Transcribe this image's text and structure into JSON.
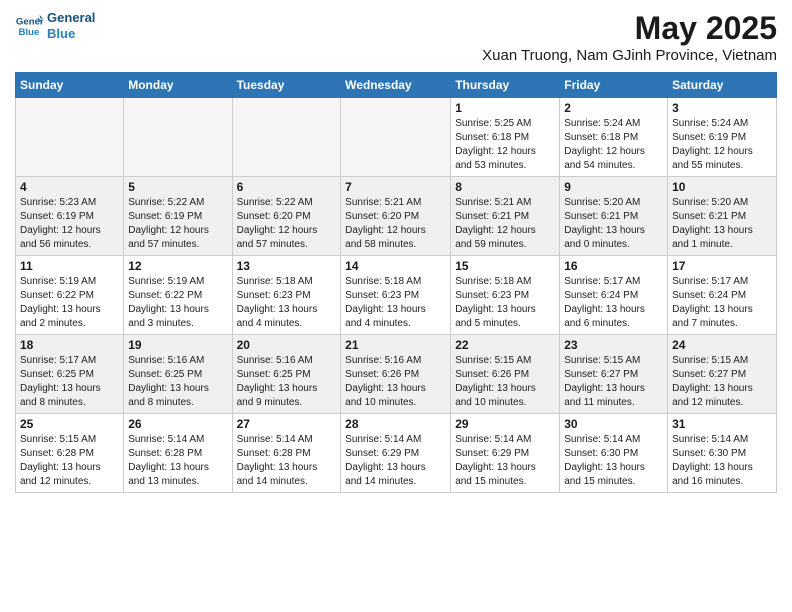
{
  "header": {
    "logo_line1": "General",
    "logo_line2": "Blue",
    "title": "May 2025",
    "subtitle": "Xuan Truong, Nam GJinh Province, Vietnam"
  },
  "columns": [
    "Sunday",
    "Monday",
    "Tuesday",
    "Wednesday",
    "Thursday",
    "Friday",
    "Saturday"
  ],
  "weeks": [
    [
      {
        "day": "",
        "info": ""
      },
      {
        "day": "",
        "info": ""
      },
      {
        "day": "",
        "info": ""
      },
      {
        "day": "",
        "info": ""
      },
      {
        "day": "1",
        "info": "Sunrise: 5:25 AM\nSunset: 6:18 PM\nDaylight: 12 hours\nand 53 minutes."
      },
      {
        "day": "2",
        "info": "Sunrise: 5:24 AM\nSunset: 6:18 PM\nDaylight: 12 hours\nand 54 minutes."
      },
      {
        "day": "3",
        "info": "Sunrise: 5:24 AM\nSunset: 6:19 PM\nDaylight: 12 hours\nand 55 minutes."
      }
    ],
    [
      {
        "day": "4",
        "info": "Sunrise: 5:23 AM\nSunset: 6:19 PM\nDaylight: 12 hours\nand 56 minutes."
      },
      {
        "day": "5",
        "info": "Sunrise: 5:22 AM\nSunset: 6:19 PM\nDaylight: 12 hours\nand 57 minutes."
      },
      {
        "day": "6",
        "info": "Sunrise: 5:22 AM\nSunset: 6:20 PM\nDaylight: 12 hours\nand 57 minutes."
      },
      {
        "day": "7",
        "info": "Sunrise: 5:21 AM\nSunset: 6:20 PM\nDaylight: 12 hours\nand 58 minutes."
      },
      {
        "day": "8",
        "info": "Sunrise: 5:21 AM\nSunset: 6:21 PM\nDaylight: 12 hours\nand 59 minutes."
      },
      {
        "day": "9",
        "info": "Sunrise: 5:20 AM\nSunset: 6:21 PM\nDaylight: 13 hours\nand 0 minutes."
      },
      {
        "day": "10",
        "info": "Sunrise: 5:20 AM\nSunset: 6:21 PM\nDaylight: 13 hours\nand 1 minute."
      }
    ],
    [
      {
        "day": "11",
        "info": "Sunrise: 5:19 AM\nSunset: 6:22 PM\nDaylight: 13 hours\nand 2 minutes."
      },
      {
        "day": "12",
        "info": "Sunrise: 5:19 AM\nSunset: 6:22 PM\nDaylight: 13 hours\nand 3 minutes."
      },
      {
        "day": "13",
        "info": "Sunrise: 5:18 AM\nSunset: 6:23 PM\nDaylight: 13 hours\nand 4 minutes."
      },
      {
        "day": "14",
        "info": "Sunrise: 5:18 AM\nSunset: 6:23 PM\nDaylight: 13 hours\nand 4 minutes."
      },
      {
        "day": "15",
        "info": "Sunrise: 5:18 AM\nSunset: 6:23 PM\nDaylight: 13 hours\nand 5 minutes."
      },
      {
        "day": "16",
        "info": "Sunrise: 5:17 AM\nSunset: 6:24 PM\nDaylight: 13 hours\nand 6 minutes."
      },
      {
        "day": "17",
        "info": "Sunrise: 5:17 AM\nSunset: 6:24 PM\nDaylight: 13 hours\nand 7 minutes."
      }
    ],
    [
      {
        "day": "18",
        "info": "Sunrise: 5:17 AM\nSunset: 6:25 PM\nDaylight: 13 hours\nand 8 minutes."
      },
      {
        "day": "19",
        "info": "Sunrise: 5:16 AM\nSunset: 6:25 PM\nDaylight: 13 hours\nand 8 minutes."
      },
      {
        "day": "20",
        "info": "Sunrise: 5:16 AM\nSunset: 6:25 PM\nDaylight: 13 hours\nand 9 minutes."
      },
      {
        "day": "21",
        "info": "Sunrise: 5:16 AM\nSunset: 6:26 PM\nDaylight: 13 hours\nand 10 minutes."
      },
      {
        "day": "22",
        "info": "Sunrise: 5:15 AM\nSunset: 6:26 PM\nDaylight: 13 hours\nand 10 minutes."
      },
      {
        "day": "23",
        "info": "Sunrise: 5:15 AM\nSunset: 6:27 PM\nDaylight: 13 hours\nand 11 minutes."
      },
      {
        "day": "24",
        "info": "Sunrise: 5:15 AM\nSunset: 6:27 PM\nDaylight: 13 hours\nand 12 minutes."
      }
    ],
    [
      {
        "day": "25",
        "info": "Sunrise: 5:15 AM\nSunset: 6:28 PM\nDaylight: 13 hours\nand 12 minutes."
      },
      {
        "day": "26",
        "info": "Sunrise: 5:14 AM\nSunset: 6:28 PM\nDaylight: 13 hours\nand 13 minutes."
      },
      {
        "day": "27",
        "info": "Sunrise: 5:14 AM\nSunset: 6:28 PM\nDaylight: 13 hours\nand 14 minutes."
      },
      {
        "day": "28",
        "info": "Sunrise: 5:14 AM\nSunset: 6:29 PM\nDaylight: 13 hours\nand 14 minutes."
      },
      {
        "day": "29",
        "info": "Sunrise: 5:14 AM\nSunset: 6:29 PM\nDaylight: 13 hours\nand 15 minutes."
      },
      {
        "day": "30",
        "info": "Sunrise: 5:14 AM\nSunset: 6:30 PM\nDaylight: 13 hours\nand 15 minutes."
      },
      {
        "day": "31",
        "info": "Sunrise: 5:14 AM\nSunset: 6:30 PM\nDaylight: 13 hours\nand 16 minutes."
      }
    ]
  ]
}
